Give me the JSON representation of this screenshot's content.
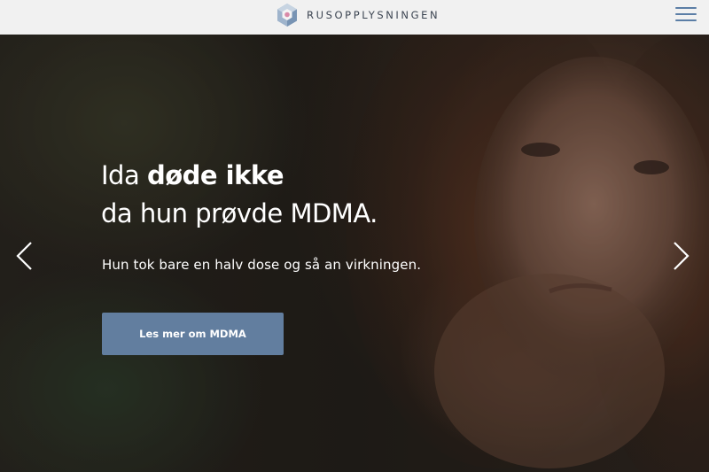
{
  "header": {
    "brand": "RUSOPPLYSNINGEN",
    "logo_icon": "hexagon-logo-icon",
    "menu_icon": "hamburger-menu-icon",
    "background": "#f1f1f1",
    "accent": "#5b7ea6"
  },
  "hero": {
    "headline_prefix": "Ida ",
    "headline_bold": "døde ikke",
    "headline_line2": "da hun prøvde MDMA.",
    "subheadline": "Hun tok bare en halv dose og så an virkningen.",
    "cta_label": "Les mer om MDMA",
    "cta_color": "#627e9f",
    "prev_icon": "chevron-left-icon",
    "next_icon": "chevron-right-icon"
  }
}
